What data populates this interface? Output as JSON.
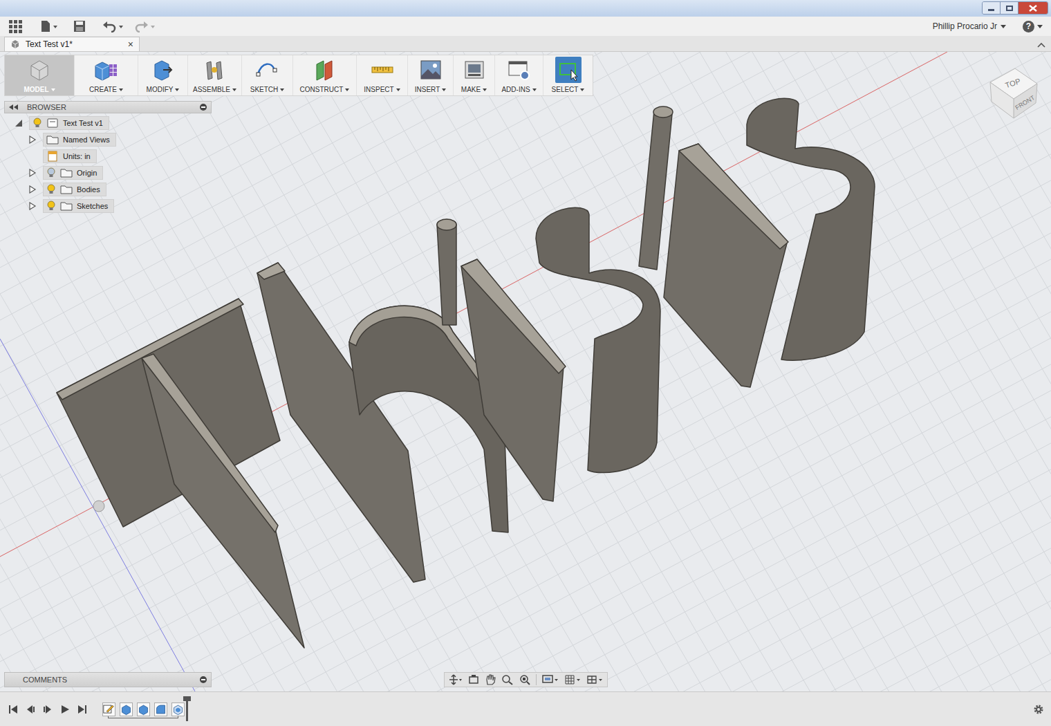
{
  "document_tab": {
    "label": "Text Test v1*",
    "close": "×",
    "selected": true
  },
  "user": "Phillip Procario Jr",
  "help": "?",
  "ribbon": [
    {
      "label": "MODEL",
      "kind": "workspace",
      "selected": true
    },
    {
      "label": "CREATE",
      "kind": "tool",
      "selected": false
    },
    {
      "label": "MODIFY",
      "kind": "tool",
      "selected": false
    },
    {
      "label": "ASSEMBLE",
      "kind": "tool",
      "selected": false
    },
    {
      "label": "SKETCH",
      "kind": "tool",
      "selected": false
    },
    {
      "label": "CONSTRUCT",
      "kind": "tool",
      "selected": false
    },
    {
      "label": "INSPECT",
      "kind": "tool",
      "selected": false
    },
    {
      "label": "INSERT",
      "kind": "tool",
      "selected": false
    },
    {
      "label": "MAKE",
      "kind": "tool",
      "selected": false
    },
    {
      "label": "ADD-INS",
      "kind": "tool",
      "selected": false
    },
    {
      "label": "SELECT",
      "kind": "tool",
      "selected": true
    }
  ],
  "browser": {
    "title": "BROWSER",
    "items": [
      {
        "label": "Text Test v1",
        "kind": "component",
        "expanded": true,
        "visible": true
      },
      {
        "label": "Named Views",
        "kind": "views",
        "expanded": false
      },
      {
        "label": "Units: in",
        "kind": "units"
      },
      {
        "label": "Origin",
        "kind": "folder",
        "expanded": false,
        "visible": false
      },
      {
        "label": "Bodies",
        "kind": "folder",
        "expanded": false,
        "visible": true
      },
      {
        "label": "Sketches",
        "kind": "folder",
        "expanded": false,
        "visible": true
      }
    ]
  },
  "comments": {
    "title": "COMMENTS"
  },
  "viewcube": {
    "top": "TOP",
    "front": "FRONT"
  },
  "timeline": {
    "features": [
      {
        "kind": "sketch"
      },
      {
        "kind": "extrude"
      },
      {
        "kind": "extrude"
      },
      {
        "kind": "fillet"
      },
      {
        "kind": "shell"
      }
    ]
  }
}
